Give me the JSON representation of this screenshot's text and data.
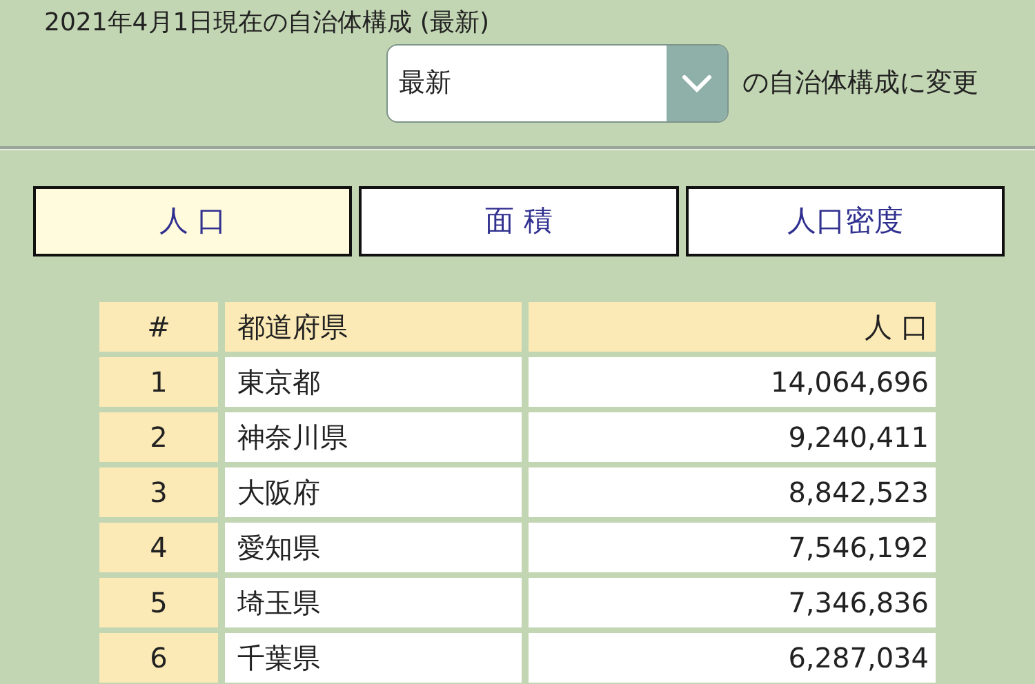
{
  "heading": "2021年4月1日現在の自治体構成 (最新)",
  "selector": {
    "value": "最新",
    "suffix": "の自治体構成に変更"
  },
  "tabs": [
    {
      "label": "人 口",
      "selected": true
    },
    {
      "label": "面 積",
      "selected": false
    },
    {
      "label": "人口密度",
      "selected": false
    }
  ],
  "table": {
    "columns": [
      "#",
      "都道府県",
      "人 口"
    ],
    "rows": [
      [
        "1",
        "東京都",
        "14,064,696"
      ],
      [
        "2",
        "神奈川県",
        "9,240,411"
      ],
      [
        "3",
        "大阪府",
        "8,842,523"
      ],
      [
        "4",
        "愛知県",
        "7,546,192"
      ],
      [
        "5",
        "埼玉県",
        "7,346,836"
      ],
      [
        "6",
        "千葉県",
        "6,287,034"
      ]
    ]
  }
}
